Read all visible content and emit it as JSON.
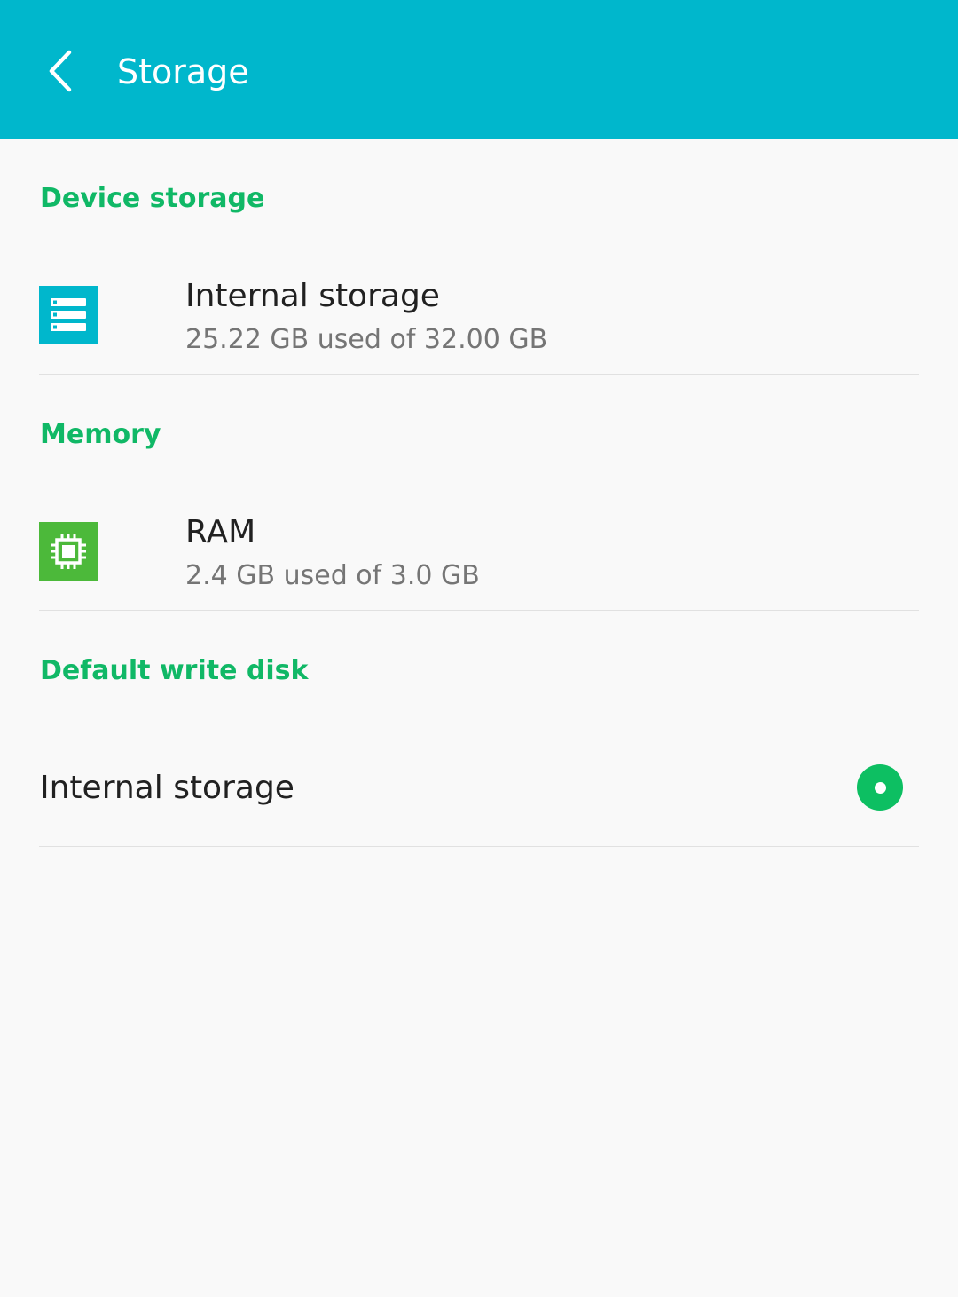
{
  "app_bar": {
    "title": "Storage",
    "back_icon": "chevron-left-icon"
  },
  "colors": {
    "app_bar": "#00b7cc",
    "section_header": "#10b866",
    "storage_icon": "#00b7cc",
    "ram_icon": "#4cb93a",
    "radio_selected": "#0dbf62"
  },
  "sections": {
    "device_storage": {
      "header": "Device storage",
      "item": {
        "title": "Internal storage",
        "summary": "25.22 GB used of 32.00 GB",
        "icon": "storage-icon"
      }
    },
    "memory": {
      "header": "Memory",
      "item": {
        "title": "RAM",
        "summary": "2.4 GB used of 3.0 GB",
        "icon": "chip-icon"
      }
    },
    "default_write_disk": {
      "header": "Default write disk",
      "item": {
        "title": "Internal storage",
        "selected": true
      }
    }
  }
}
